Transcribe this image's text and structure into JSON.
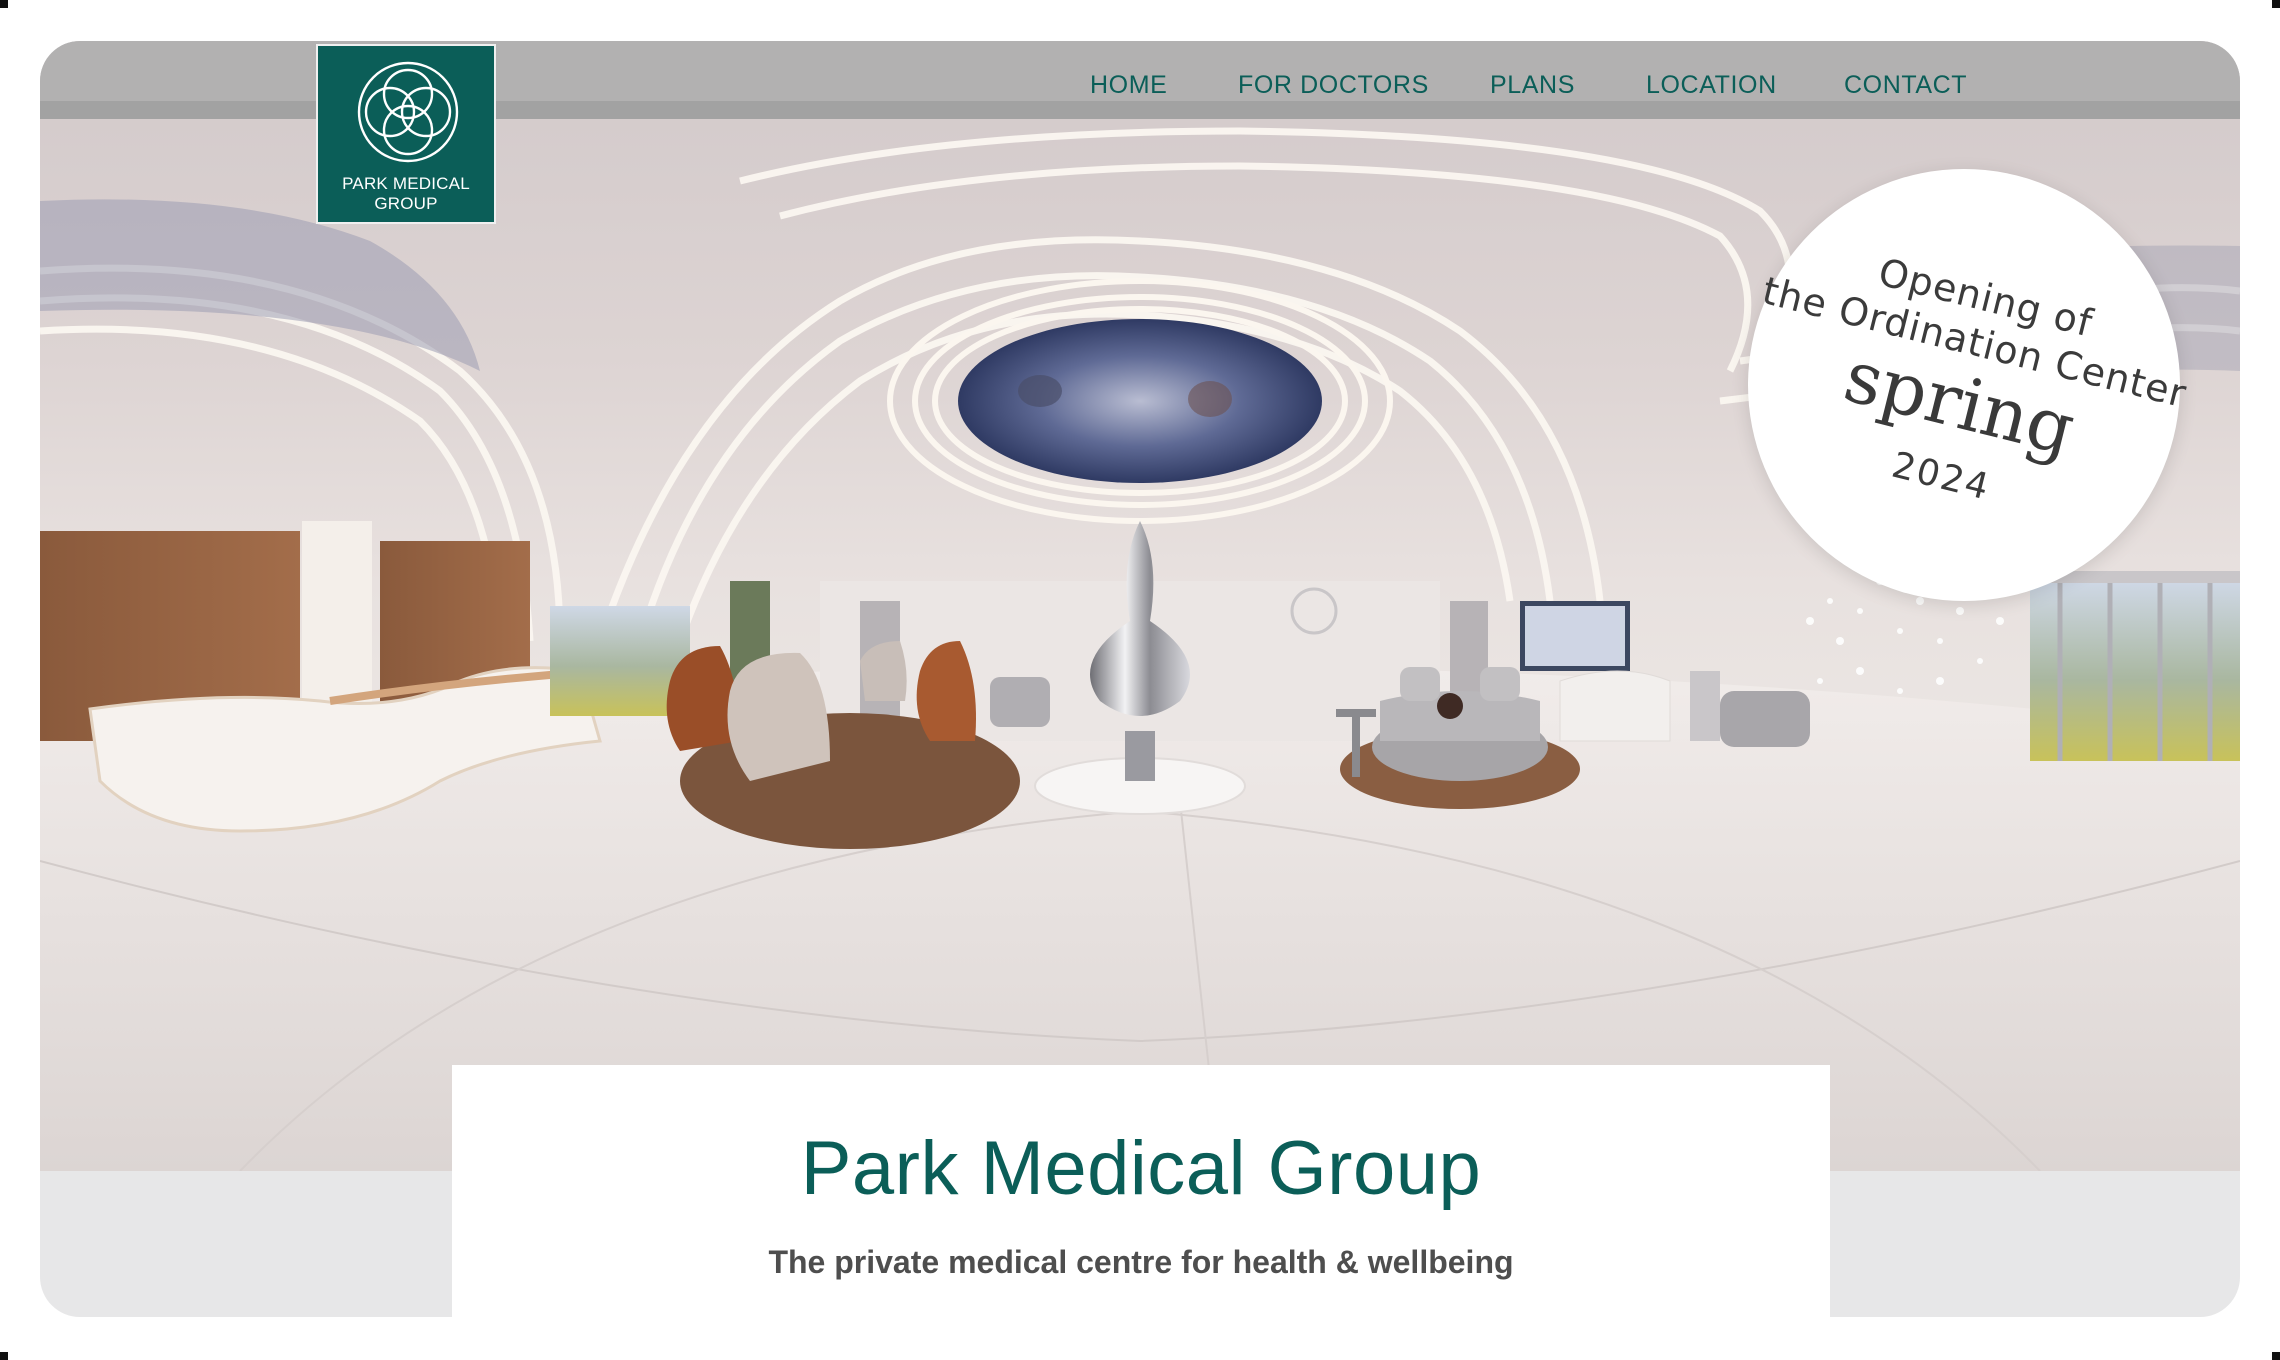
{
  "brand": {
    "logo_line1": "PARK MEDICAL",
    "logo_line2": "GROUP",
    "primary_color": "#0b5e58"
  },
  "nav": {
    "items": [
      {
        "label": "HOME"
      },
      {
        "label": "FOR DOCTORS"
      },
      {
        "label": "PLANS"
      },
      {
        "label": "LOCATION"
      },
      {
        "label": "CONTACT"
      }
    ]
  },
  "badge": {
    "line1": "Opening of",
    "line2": "the Ordination Center",
    "line3": "spring",
    "line4": "2024"
  },
  "hero": {
    "image": "panoramic-lobby-rendering"
  },
  "card": {
    "title": "Park Medical Group",
    "subtitle": "The private medical centre for health & wellbeing"
  }
}
